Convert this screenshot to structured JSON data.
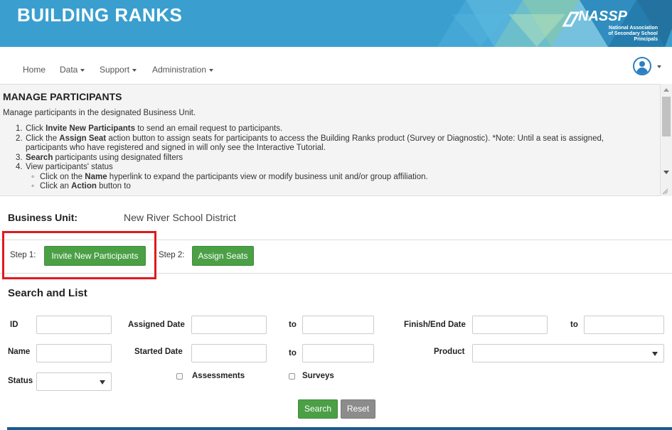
{
  "banner": {
    "title": "BUILDING RANKS",
    "logo_name": "NASSP",
    "logo_sub_line1": "National Association",
    "logo_sub_line2": "of Secondary School Principals",
    "color": "#3a9fcf"
  },
  "nav": {
    "items": [
      {
        "label": "Home",
        "has_caret": false
      },
      {
        "label": "Data",
        "has_caret": true
      },
      {
        "label": "Support",
        "has_caret": true
      },
      {
        "label": "Administration",
        "has_caret": true
      }
    ],
    "user_icon": "user-avatar-icon"
  },
  "instructions": {
    "title": "MANAGE PARTICIPANTS",
    "intro": "Manage participants in the designated Business Unit.",
    "steps": [
      {
        "num": "1.",
        "bold": "Invite New Participants",
        "pre": "Click ",
        "post": " to send an email request to participants."
      },
      {
        "num": "2.",
        "bold": "Assign Seat",
        "pre": "Click the ",
        "post": " action button to assign seats for participants to access the Building Ranks product (Survey or Diagnostic). *Note: Until a seat is assigned,"
      },
      {
        "num": "",
        "bold": "",
        "pre": "participants who have registered and signed in will only see the Interactive Tutorial.",
        "post": ""
      },
      {
        "num": "3.",
        "bold": "Search",
        "pre": "",
        "post": " participants using designated filters"
      },
      {
        "num": "4.",
        "bold": "",
        "pre": "View participants' status",
        "post": ""
      }
    ],
    "substeps": [
      {
        "bold": "Name",
        "pre": "Click on the ",
        "post": " hyperlink to expand the participants view or modify business unit and/or group affiliation."
      },
      {
        "bold": "Action",
        "pre": "Click an ",
        "post": " button to"
      }
    ]
  },
  "business_unit": {
    "label": "Business Unit:",
    "value": "New River School District"
  },
  "steps": {
    "step1_label": "Step 1:",
    "step1_button": "Invite New Participants",
    "step2_label": "Step 2:",
    "step2_button": "Assign Seats",
    "highlight_color": "#e0191d"
  },
  "search": {
    "title": "Search and List",
    "id_label": "ID",
    "id_value": "",
    "assigned_date_label": "Assigned Date",
    "assigned_date_from": "",
    "assigned_to_label": "to",
    "assigned_date_to": "",
    "finish_date_label": "Finish/End Date",
    "finish_date_from": "",
    "finish_to_label": "to",
    "finish_date_to": "",
    "name_label": "Name",
    "name_value": "",
    "started_date_label": "Started Date",
    "started_date_from": "",
    "started_to_label": "to",
    "started_date_to": "",
    "product_label": "Product",
    "product_value": "",
    "status_label": "Status",
    "status_value": "",
    "assessments_label": "Assessments",
    "surveys_label": "Surveys",
    "search_button": "Search",
    "reset_button": "Reset"
  },
  "colors": {
    "primary_green": "#4ba046",
    "grey_button": "#8c8c8c",
    "footer_bar": "#1a5d8c"
  }
}
